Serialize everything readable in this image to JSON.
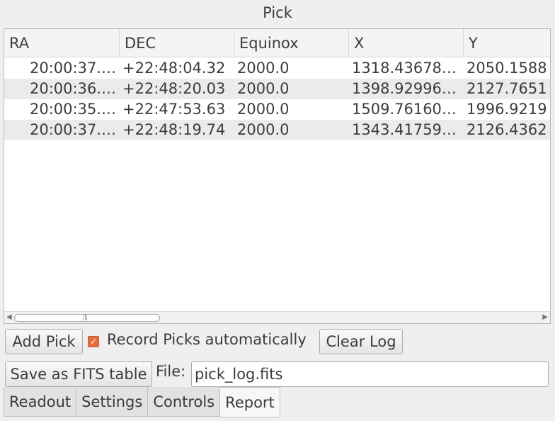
{
  "panel": {
    "title": "Pick"
  },
  "table": {
    "columns": [
      "RA",
      "DEC",
      "Equinox",
      "X",
      "Y"
    ],
    "rows": [
      [
        "20:00:37.…",
        "+22:48:04.32",
        "2000.0",
        "1318.43678…",
        "2050.1588"
      ],
      [
        "20:00:36.…",
        "+22:48:20.03",
        "2000.0",
        "1398.92996…",
        "2127.7651"
      ],
      [
        "20:00:35.…",
        "+22:47:53.63",
        "2000.0",
        "1509.76160…",
        "1996.9219"
      ],
      [
        "20:00:37.…",
        "+22:48:19.74",
        "2000.0",
        "1343.41759…",
        "2126.4362"
      ]
    ]
  },
  "controls": {
    "add_pick": "Add Pick",
    "record_label": "Record Picks automatically",
    "record_checked": true,
    "clear_log": "Clear Log",
    "save_fits": "Save as FITS table",
    "file_label": "File:",
    "file_value": "pick_log.fits"
  },
  "tabs": [
    {
      "label": "Readout",
      "active": false
    },
    {
      "label": "Settings",
      "active": false
    },
    {
      "label": "Controls",
      "active": false
    },
    {
      "label": "Report",
      "active": true
    }
  ],
  "colors": {
    "checkbox_accent": "#e96c3a",
    "row_alt": "#ebebeb",
    "background": "#efefef"
  }
}
